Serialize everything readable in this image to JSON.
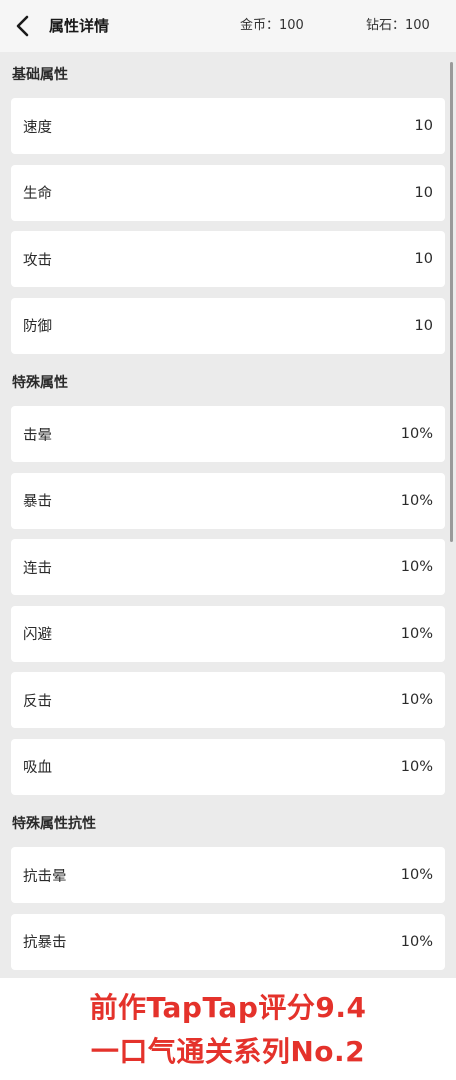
{
  "header": {
    "back_icon": "chevron-left-icon",
    "title": "属性详情",
    "gold": "金币：100",
    "diamond": "钻石：100"
  },
  "sections": {
    "basic": {
      "title": "基础属性",
      "items": [
        {
          "label": "速度",
          "value": "10"
        },
        {
          "label": "生命",
          "value": "10"
        },
        {
          "label": "攻击",
          "value": "10"
        },
        {
          "label": "防御",
          "value": "10"
        }
      ]
    },
    "special": {
      "title": "特殊属性",
      "items": [
        {
          "label": "击晕",
          "value": "10%"
        },
        {
          "label": "暴击",
          "value": "10%"
        },
        {
          "label": "连击",
          "value": "10%"
        },
        {
          "label": "闪避",
          "value": "10%"
        },
        {
          "label": "反击",
          "value": "10%"
        },
        {
          "label": "吸血",
          "value": "10%"
        }
      ]
    },
    "resist": {
      "title": "特殊属性抗性",
      "items": [
        {
          "label": "抗击晕",
          "value": "10%"
        },
        {
          "label": "抗暴击",
          "value": "10%"
        }
      ]
    }
  },
  "banner": {
    "line1": "前作TapTap评分9.4",
    "line2": "一口气通关系列No.2",
    "color": "#e4322b"
  }
}
